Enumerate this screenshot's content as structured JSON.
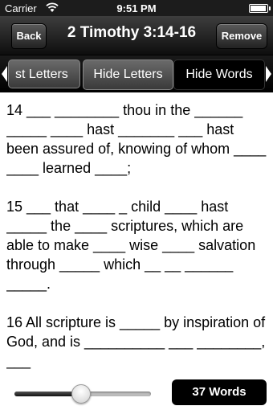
{
  "status_bar": {
    "carrier": "Carrier",
    "wifi_icon": "wifi-icon",
    "time": "9:51 PM",
    "battery_icon": "battery-icon",
    "battery_level": 0.95
  },
  "nav": {
    "back_label": "Back",
    "title": "2 Timothy 3:14-16",
    "remove_label": "Remove"
  },
  "segments": {
    "left_arrow_icon": "chevron-left-icon",
    "right_arrow_icon": "chevron-right-icon",
    "items": [
      "st Letters",
      "Hide Letters",
      "Hide Words"
    ],
    "selected": "Hide Words"
  },
  "verses": [
    "14 ___ ________ thou in the ______ _____ ____ hast _______ ___ hast been assured of, knowing of whom ____ ____ learned ____;",
    "15 ___ that ____ _ child ____ hast _____ the ____ scriptures, which are able to make ____ wise ____ salvation through _____ which __ __ ______ _____.",
    "16 All scripture is _____ by inspiration of God, and is __________ ___ ________, ___"
  ],
  "bottom": {
    "slider_value": 0.48,
    "word_count_label": "37 Words"
  },
  "colors": {
    "bar_dark": "#0e0e0e",
    "selected_segment": "#000000",
    "text": "#000000"
  }
}
